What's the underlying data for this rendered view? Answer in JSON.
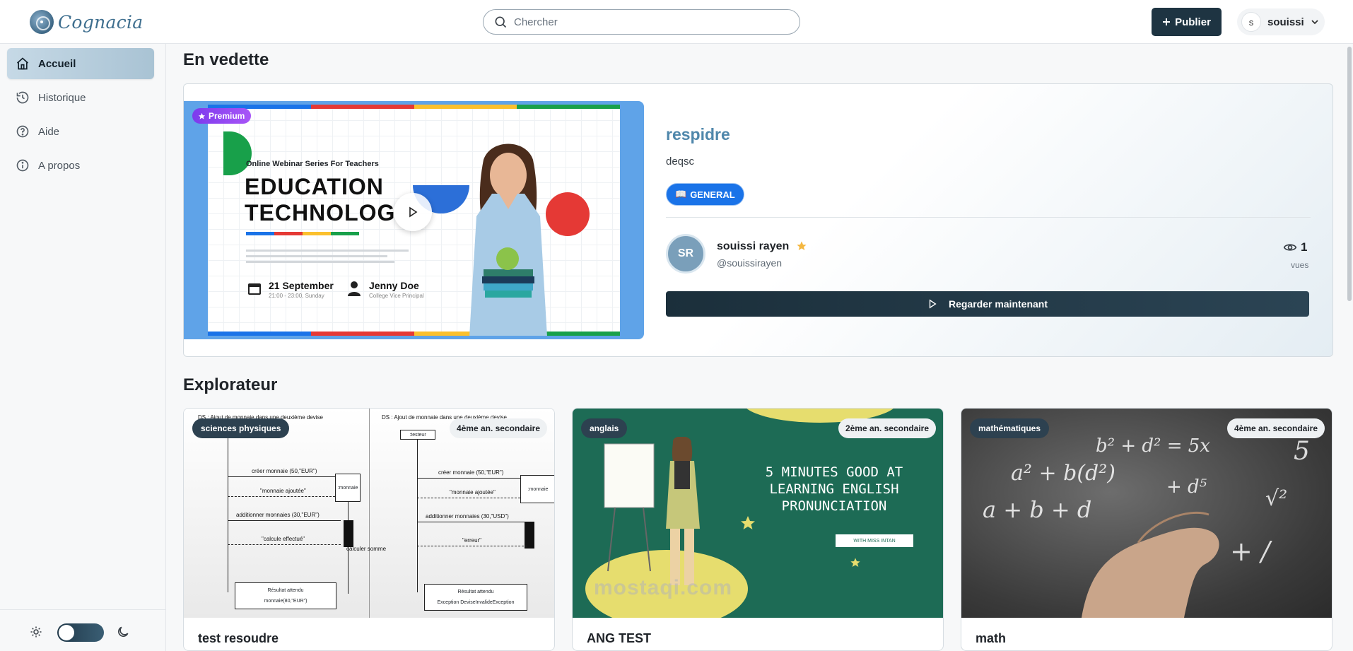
{
  "app": {
    "name": "Cognacia"
  },
  "search": {
    "placeholder": "Chercher"
  },
  "header": {
    "publish_label": "Publier",
    "user_initial": "s",
    "user_name": "souissi"
  },
  "sidebar": {
    "items": [
      {
        "label": "Accueil",
        "icon": "home-icon",
        "active": true
      },
      {
        "label": "Historique",
        "icon": "history-icon",
        "active": false
      },
      {
        "label": "Aide",
        "icon": "help-icon",
        "active": false
      },
      {
        "label": "A propos",
        "icon": "info-icon",
        "active": false
      }
    ]
  },
  "featured": {
    "section_title": "En vedette",
    "badge": "Premium",
    "thumbnail": {
      "subtitle": "Online Webinar Series For Teachers",
      "title_line1": "EDUCATION",
      "title_line2": "TECHNOLOG",
      "date": "21 September",
      "time": "21:00 - 23:00, Sunday",
      "person": "Jenny Doe",
      "role": "College Vice Principal"
    },
    "title": "respidre",
    "description": "deqsc",
    "tag": "GENERAL",
    "tag_emoji": "📖",
    "author": {
      "initials": "SR",
      "name": "souissi rayen",
      "handle": "@souissirayen"
    },
    "views_count": "1",
    "views_label": "vues",
    "watch_label": "Regarder maintenant"
  },
  "explorer": {
    "section_title": "Explorateur",
    "cards": [
      {
        "title": "test resoudre",
        "subject": "sciences physiques",
        "level": "4ème an. secondaire"
      },
      {
        "title": "ANG TEST",
        "subject": "anglais",
        "level": "2ème an. secondaire"
      },
      {
        "title": "math",
        "subject": "mathématiques",
        "level": "4ème an. secondaire"
      }
    ]
  },
  "card1_thumb": {
    "left_header": "DS : Ajout de monnaie dans une deuxième devise",
    "right_header": "DS : Ajout de monnaie dans une deuxième devise",
    "obj1": ":testeur",
    "obj2": ":monnaie",
    "msg1": "créer monnaie (50,\"EUR\")",
    "msg2": "\"monnaie ajoutée\"",
    "msg3_left": "additionner monnaies (30,\"EUR\")",
    "msg3_right": "additionner monnaies (30,\"USD\")",
    "msg4_left": "\"calcule effectué\"",
    "msg4_right": "\"erreur\"",
    "self_call": "calculer somme",
    "result_label": "Résultat attendu",
    "result_left": "monnaie(80,\"EUR\")",
    "result_right": "Exception DeviseInvalideException"
  },
  "card2_thumb": {
    "headline": "5 MINUTES GOOD AT LEARNING ENGLISH PRONUNCIATION",
    "tag": "WITH MISS INTAN"
  },
  "watermark": "mostaqi.com",
  "colors": {
    "brand": "#3f6f8f",
    "dark": "#1e3442",
    "premium": "#7c3aed",
    "tag": "#1a73e8"
  }
}
